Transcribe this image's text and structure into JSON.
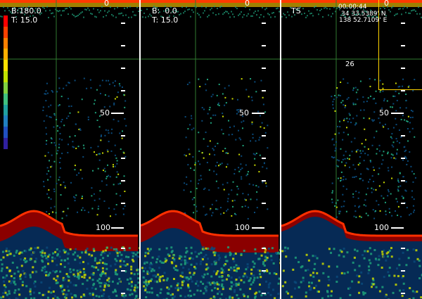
{
  "panels": [
    {
      "id": "p1",
      "label_b": "B:180.0",
      "label_t": "T: 15.0",
      "depth_labels": [
        "0",
        "50",
        "100"
      ]
    },
    {
      "id": "p2",
      "label_b": "B:  0.0",
      "label_t": "T: 15.0",
      "depth_labels": [
        "0",
        "50",
        "100"
      ]
    },
    {
      "id": "p3",
      "label_ts": "TS",
      "time": "00:00:44",
      "lat": "34 33.5389' N",
      "lon": "138 52.7109' E",
      "marker_value": "26",
      "depth_labels": [
        "0",
        "50",
        "100"
      ]
    }
  ],
  "colors": {
    "surface": "#ff3a00",
    "seabed": "#8b0000",
    "seabed_edge": "#ff3000",
    "noise_low": "#0a4a7a",
    "noise_mid": "#1fa07a",
    "noise_high": "#c8d800",
    "box": "#ffd400"
  },
  "colorbar_colors": [
    "#ff0000",
    "#ff4000",
    "#ff8000",
    "#ffb000",
    "#ffe000",
    "#c0e000",
    "#80d040",
    "#40c080",
    "#20a0a0",
    "#2080c0",
    "#2050c0",
    "#3020a0"
  ]
}
